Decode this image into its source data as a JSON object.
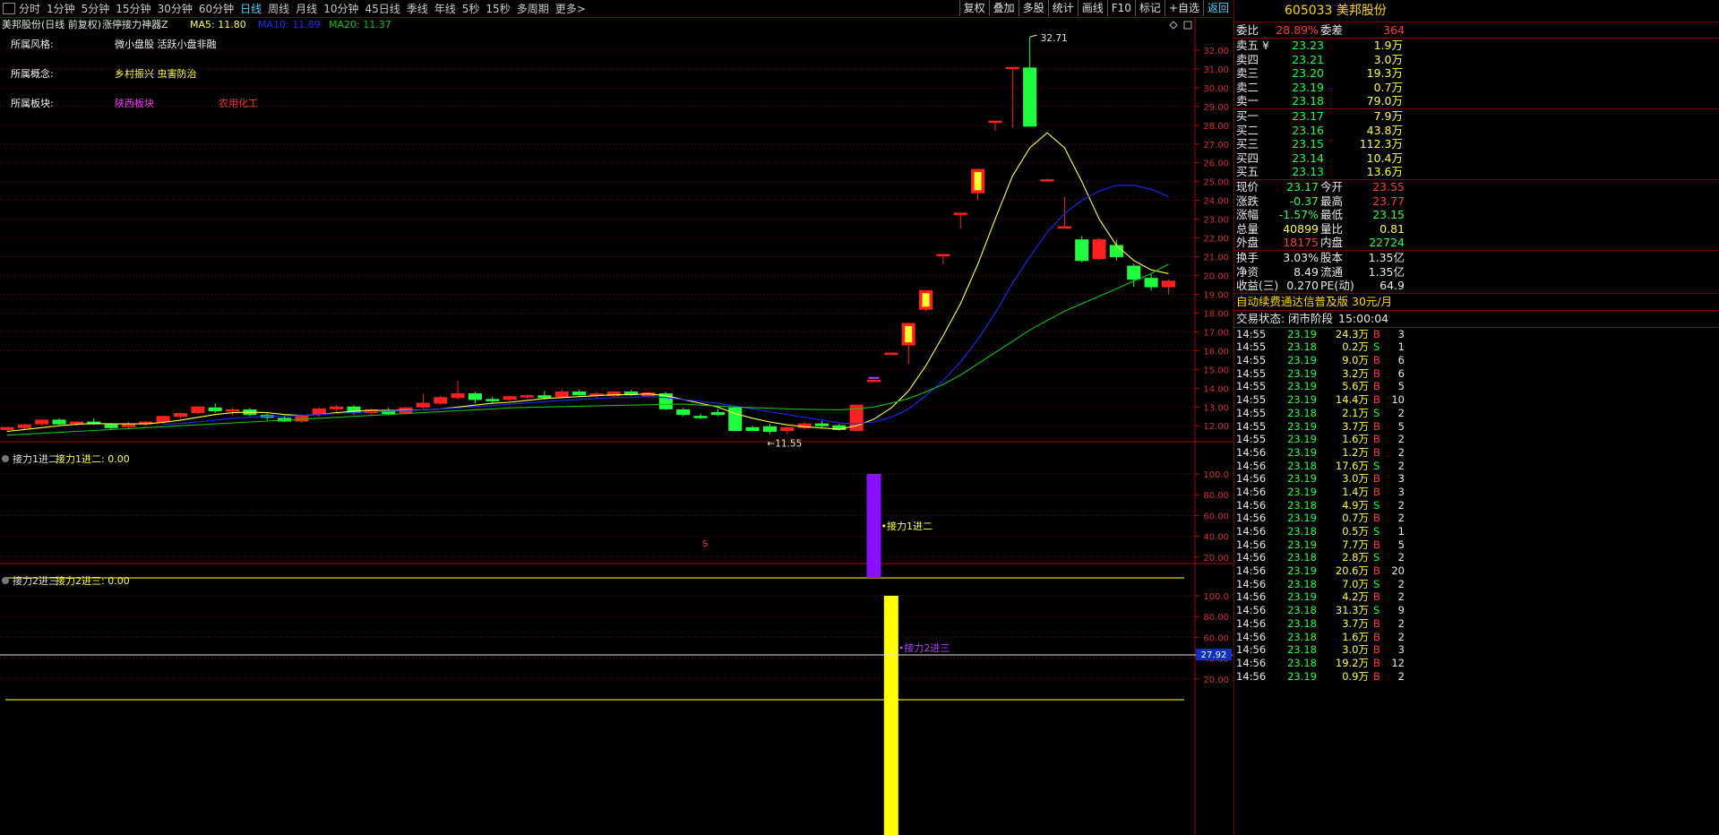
{
  "toolbar": {
    "periods": [
      "分时",
      "1分钟",
      "5分钟",
      "15分钟",
      "30分钟",
      "60分钟",
      "日线",
      "周线",
      "月线",
      "10分钟",
      "45日线",
      "季线",
      "年线",
      "5秒",
      "15秒",
      "多周期",
      "更多>"
    ],
    "active_period": "日线",
    "right_buttons": [
      "复权",
      "叠加",
      "多股",
      "统计",
      "画线",
      "F10",
      "标记",
      "+自选",
      "返回"
    ]
  },
  "main_panel": {
    "title": "美邦股份(日线 前复权)",
    "indicator": "涨停接力神器Z",
    "ma5": "MA5: 11.80",
    "ma10": "MA10: 11.89",
    "ma20": "MA20: 11.37",
    "info_labels": [
      "所属风格:",
      "所属概念:",
      "所属板块:"
    ],
    "style_value": "微小盘股 活跃小盘非融",
    "concept_value": "乡村振兴 虫害防治",
    "sector_values": [
      "陕西板块",
      "农用化工"
    ],
    "high_label": "32.71",
    "low_label": "11.55",
    "s_marker": "S",
    "colors": {
      "up": "#ff2020",
      "down": "#1fff3f",
      "ma5": "#ffff40",
      "ma10": "#1a2aff",
      "ma20": "#10c010",
      "axis": "#b00000",
      "grid": "#6a0000"
    }
  },
  "sub_panel_1": {
    "title": "接力1进二",
    "label": "接力1进二: 0.00",
    "annotation": "接力1进二",
    "color": "#8a10ff"
  },
  "sub_panel_2": {
    "title": "接力2进三",
    "label": "接力2进三: 0.00",
    "annotation": "接力2进三",
    "color": "#ffff00",
    "crosshair_value": "27.92"
  },
  "chart_data": {
    "type": "candlestick",
    "y_ticks": [
      "32.00",
      "31.00",
      "30.00",
      "29.00",
      "28.00",
      "27.00",
      "26.00",
      "25.00",
      "24.00",
      "23.00",
      "22.00",
      "21.00",
      "20.00",
      "19.00",
      "18.00",
      "17.00",
      "16.00",
      "15.00",
      "14.00",
      "13.00",
      "12.00"
    ],
    "ylim": [
      11.2,
      33.0
    ],
    "candles": [
      [
        11.8,
        11.95,
        11.7,
        11.9
      ],
      [
        11.9,
        12.1,
        11.8,
        12.05
      ],
      [
        12.1,
        12.35,
        12.0,
        12.3
      ],
      [
        12.3,
        12.4,
        12.05,
        12.1
      ],
      [
        12.15,
        12.25,
        12.0,
        12.2
      ],
      [
        12.2,
        12.4,
        12.05,
        12.1
      ],
      [
        12.05,
        12.15,
        11.8,
        11.9
      ],
      [
        11.95,
        12.2,
        11.85,
        12.1
      ],
      [
        12.1,
        12.25,
        12.0,
        12.2
      ],
      [
        12.2,
        12.55,
        12.1,
        12.5
      ],
      [
        12.5,
        12.7,
        12.4,
        12.65
      ],
      [
        12.7,
        13.05,
        12.6,
        13.0
      ],
      [
        12.95,
        13.2,
        12.7,
        12.8
      ],
      [
        12.8,
        12.95,
        12.55,
        12.85
      ],
      [
        12.85,
        12.95,
        12.5,
        12.6
      ],
      [
        12.55,
        12.65,
        12.3,
        12.45
      ],
      [
        12.4,
        12.5,
        12.2,
        12.25
      ],
      [
        12.25,
        12.6,
        12.15,
        12.55
      ],
      [
        12.6,
        12.95,
        12.5,
        12.9
      ],
      [
        12.9,
        13.1,
        12.75,
        13.0
      ],
      [
        13.0,
        13.1,
        12.6,
        12.7
      ],
      [
        12.7,
        12.9,
        12.6,
        12.85
      ],
      [
        12.8,
        12.95,
        12.55,
        12.65
      ],
      [
        12.7,
        13.0,
        12.6,
        12.95
      ],
      [
        13.0,
        13.7,
        12.9,
        13.2
      ],
      [
        13.2,
        13.6,
        13.1,
        13.5
      ],
      [
        13.5,
        14.4,
        13.4,
        13.7
      ],
      [
        13.7,
        13.8,
        13.2,
        13.4
      ],
      [
        13.4,
        13.55,
        13.2,
        13.35
      ],
      [
        13.4,
        13.6,
        13.3,
        13.55
      ],
      [
        13.55,
        13.65,
        13.45,
        13.6
      ],
      [
        13.6,
        13.85,
        13.4,
        13.5
      ],
      [
        13.55,
        13.95,
        13.5,
        13.8
      ],
      [
        13.8,
        13.9,
        13.55,
        13.65
      ],
      [
        13.65,
        13.8,
        13.5,
        13.7
      ],
      [
        13.6,
        13.85,
        13.5,
        13.8
      ],
      [
        13.8,
        13.9,
        13.6,
        13.7
      ],
      [
        13.6,
        13.8,
        13.5,
        13.75
      ],
      [
        13.7,
        13.8,
        12.85,
        12.9
      ],
      [
        12.85,
        12.95,
        12.5,
        12.6
      ],
      [
        12.5,
        12.65,
        12.35,
        12.45
      ],
      [
        12.7,
        12.9,
        12.5,
        12.6
      ],
      [
        12.95,
        13.05,
        11.7,
        11.75
      ],
      [
        11.9,
        12.0,
        11.7,
        11.75
      ],
      [
        11.95,
        12.1,
        11.55,
        11.7
      ],
      [
        11.75,
        11.95,
        11.55,
        11.9
      ],
      [
        11.9,
        12.2,
        11.8,
        12.1
      ],
      [
        12.1,
        12.25,
        11.9,
        12.0
      ],
      [
        12.0,
        12.1,
        11.75,
        11.8
      ],
      [
        11.75,
        13.1,
        11.7,
        13.1
      ],
      [
        14.4,
        14.45,
        14.4,
        14.42
      ],
      [
        15.85,
        15.9,
        15.85,
        15.87
      ],
      [
        16.3,
        17.45,
        15.3,
        17.45
      ],
      [
        18.2,
        19.2,
        18.1,
        19.2
      ],
      [
        21.1,
        21.15,
        20.6,
        21.12
      ],
      [
        23.3,
        23.35,
        22.5,
        23.32
      ],
      [
        24.4,
        25.65,
        24.0,
        25.65
      ],
      [
        28.2,
        28.25,
        27.7,
        28.22
      ],
      [
        31.05,
        31.1,
        27.85,
        31.08
      ],
      [
        31.05,
        32.71,
        27.95,
        27.95
      ],
      [
        25.1,
        25.15,
        25.05,
        25.1
      ],
      [
        22.6,
        24.2,
        22.55,
        22.6
      ],
      [
        21.9,
        22.1,
        20.7,
        20.8
      ],
      [
        20.9,
        22.0,
        20.8,
        21.9
      ],
      [
        21.6,
        21.9,
        20.8,
        21.0
      ],
      [
        20.5,
        20.65,
        19.4,
        19.8
      ],
      [
        19.85,
        20.1,
        19.2,
        19.4
      ],
      [
        19.4,
        19.8,
        19.0,
        19.7
      ]
    ],
    "ma5": [
      11.7,
      11.8,
      11.9,
      12.0,
      12.08,
      12.12,
      12.1,
      12.1,
      12.1,
      12.18,
      12.3,
      12.45,
      12.6,
      12.7,
      12.72,
      12.7,
      12.6,
      12.55,
      12.6,
      12.7,
      12.78,
      12.82,
      12.82,
      12.82,
      12.85,
      12.9,
      13.0,
      13.1,
      13.2,
      13.25,
      13.35,
      13.45,
      13.5,
      13.55,
      13.6,
      13.65,
      13.65,
      13.7,
      13.6,
      13.4,
      13.2,
      13.0,
      12.65,
      12.4,
      12.2,
      12.05,
      11.95,
      11.88,
      11.82,
      12.0,
      12.35,
      12.95,
      13.85,
      15.2,
      16.8,
      18.5,
      20.6,
      23.0,
      25.3,
      26.8,
      27.6,
      26.8,
      25.0,
      23.0,
      21.6,
      20.8,
      20.3,
      20.1
    ],
    "ma10": [
      null,
      null,
      null,
      null,
      null,
      null,
      null,
      null,
      null,
      12.08,
      12.12,
      12.2,
      12.3,
      12.4,
      12.45,
      12.5,
      12.52,
      12.55,
      12.6,
      12.65,
      12.7,
      12.75,
      12.78,
      12.8,
      12.85,
      12.9,
      12.95,
      13.02,
      13.08,
      13.15,
      13.22,
      13.28,
      13.35,
      13.4,
      13.45,
      13.5,
      13.52,
      13.55,
      13.5,
      13.4,
      13.3,
      13.2,
      13.05,
      12.9,
      12.75,
      12.6,
      12.45,
      12.3,
      12.15,
      12.1,
      12.2,
      12.45,
      12.9,
      13.6,
      14.4,
      15.4,
      16.6,
      18.0,
      19.6,
      21.0,
      22.3,
      23.3,
      24.0,
      24.5,
      24.8,
      24.8,
      24.6,
      24.2,
      23.6,
      23.0
    ],
    "ma20": [
      11.5,
      11.55,
      11.6,
      11.65,
      11.7,
      11.75,
      11.8,
      11.85,
      11.9,
      11.95,
      12.0,
      12.05,
      12.1,
      12.15,
      12.2,
      12.25,
      12.3,
      12.35,
      12.4,
      12.45,
      12.5,
      12.55,
      12.6,
      12.65,
      12.7,
      12.75,
      12.8,
      12.85,
      12.9,
      12.95,
      12.98,
      13.0,
      13.02,
      13.04,
      13.06,
      13.08,
      13.1,
      13.12,
      13.14,
      13.15,
      13.1,
      13.05,
      13.0,
      12.96,
      12.93,
      12.9,
      12.88,
      12.86,
      12.85,
      12.9,
      13.0,
      13.2,
      13.45,
      13.8,
      14.2,
      14.7,
      15.3,
      15.9,
      16.5,
      17.1,
      17.6,
      18.1,
      18.5,
      18.9,
      19.3,
      19.7,
      20.1,
      20.6
    ],
    "sub1": {
      "y_ticks": [
        "100.0",
        "80.00",
        "60.00",
        "40.00",
        "20.00"
      ],
      "ylim": [
        0,
        100
      ],
      "bar_index": 50,
      "bar_value": 100
    },
    "sub2": {
      "y_ticks": [
        "100.0",
        "80.00",
        "60.00",
        "40.00",
        "20.00"
      ],
      "ylim": [
        0,
        100
      ],
      "bar_index": 51,
      "bar_value": 100
    }
  },
  "stock": {
    "code": "605033",
    "name": "美邦股份",
    "wei_bi_label": "委比",
    "wei_bi_value": "28.89%",
    "wei_cha_label": "委差",
    "wei_cha_value": "364"
  },
  "order_book": {
    "sells": [
      {
        "label": "卖五 ¥",
        "price": "23.23",
        "vol": "1.9万"
      },
      {
        "label": "卖四",
        "price": "23.21",
        "vol": "3.0万"
      },
      {
        "label": "卖三",
        "price": "23.20",
        "vol": "19.3万"
      },
      {
        "label": "卖二",
        "price": "23.19",
        "vol": "0.7万"
      },
      {
        "label": "卖一",
        "price": "23.18",
        "vol": "79.0万"
      }
    ],
    "buys": [
      {
        "label": "买一",
        "price": "23.17",
        "vol": "7.9万"
      },
      {
        "label": "买二",
        "price": "23.16",
        "vol": "43.8万"
      },
      {
        "label": "买三",
        "price": "23.15",
        "vol": "112.3万"
      },
      {
        "label": "买四",
        "price": "23.14",
        "vol": "10.4万"
      },
      {
        "label": "买五",
        "price": "23.13",
        "vol": "13.6万"
      }
    ]
  },
  "quote_stats": [
    [
      {
        "l": "现价",
        "v": "23.17",
        "c": "g"
      },
      {
        "l": "今开",
        "v": "23.55",
        "c": "r"
      }
    ],
    [
      {
        "l": "涨跌",
        "v": "-0.37",
        "c": "g"
      },
      {
        "l": "最高",
        "v": "23.77",
        "c": "r"
      }
    ],
    [
      {
        "l": "涨幅",
        "v": "-1.57%",
        "c": "g"
      },
      {
        "l": "最低",
        "v": "23.15",
        "c": "g"
      }
    ],
    [
      {
        "l": "总量",
        "v": "40899",
        "c": "y"
      },
      {
        "l": "量比",
        "v": "0.81",
        "c": "y"
      }
    ],
    [
      {
        "l": "外盘",
        "v": "18175",
        "c": "r"
      },
      {
        "l": "内盘",
        "v": "22724",
        "c": "g"
      }
    ]
  ],
  "quote_stats2": [
    [
      {
        "l": "换手",
        "v": "3.03%",
        "c": "w"
      },
      {
        "l": "股本",
        "v": "1.35亿",
        "c": "w"
      }
    ],
    [
      {
        "l": "净资",
        "v": "8.49",
        "c": "w"
      },
      {
        "l": "流通",
        "v": "1.35亿",
        "c": "w"
      }
    ],
    [
      {
        "l": "收益(三)",
        "v": "0.270",
        "c": "w"
      },
      {
        "l": "PE(动)",
        "v": "64.9",
        "c": "w"
      }
    ]
  ],
  "promo": {
    "text": "自动续费通达信普及版",
    "price": "30元/月"
  },
  "trade_status": {
    "label": "交易状态:",
    "value": "闭市阶段",
    "time": "15:00:04"
  },
  "trades": [
    {
      "t": "14:55",
      "p": "23.19",
      "v": "24.3万",
      "s": "B",
      "n": "3"
    },
    {
      "t": "14:55",
      "p": "23.18",
      "v": "0.2万",
      "s": "S",
      "n": "1"
    },
    {
      "t": "14:55",
      "p": "23.19",
      "v": "9.0万",
      "s": "B",
      "n": "6"
    },
    {
      "t": "14:55",
      "p": "23.19",
      "v": "3.2万",
      "s": "B",
      "n": "6"
    },
    {
      "t": "14:55",
      "p": "23.19",
      "v": "5.6万",
      "s": "B",
      "n": "5"
    },
    {
      "t": "14:55",
      "p": "23.19",
      "v": "14.4万",
      "s": "B",
      "n": "10"
    },
    {
      "t": "14:55",
      "p": "23.18",
      "v": "2.1万",
      "s": "S",
      "n": "2"
    },
    {
      "t": "14:55",
      "p": "23.19",
      "v": "3.7万",
      "s": "B",
      "n": "5"
    },
    {
      "t": "14:55",
      "p": "23.19",
      "v": "1.6万",
      "s": "B",
      "n": "2"
    },
    {
      "t": "14:56",
      "p": "23.19",
      "v": "1.2万",
      "s": "B",
      "n": "2"
    },
    {
      "t": "14:56",
      "p": "23.18",
      "v": "17.6万",
      "s": "S",
      "n": "2"
    },
    {
      "t": "14:56",
      "p": "23.19",
      "v": "3.0万",
      "s": "B",
      "n": "3"
    },
    {
      "t": "14:56",
      "p": "23.19",
      "v": "1.4万",
      "s": "B",
      "n": "3"
    },
    {
      "t": "14:56",
      "p": "23.18",
      "v": "4.9万",
      "s": "S",
      "n": "2"
    },
    {
      "t": "14:56",
      "p": "23.19",
      "v": "0.7万",
      "s": "B",
      "n": "2"
    },
    {
      "t": "14:56",
      "p": "23.18",
      "v": "0.5万",
      "s": "S",
      "n": "1"
    },
    {
      "t": "14:56",
      "p": "23.19",
      "v": "7.7万",
      "s": "B",
      "n": "5"
    },
    {
      "t": "14:56",
      "p": "23.18",
      "v": "2.8万",
      "s": "S",
      "n": "2"
    },
    {
      "t": "14:56",
      "p": "23.19",
      "v": "20.6万",
      "s": "B",
      "n": "20"
    },
    {
      "t": "14:56",
      "p": "23.18",
      "v": "7.0万",
      "s": "S",
      "n": "2"
    },
    {
      "t": "14:56",
      "p": "23.19",
      "v": "4.2万",
      "s": "B",
      "n": "2"
    },
    {
      "t": "14:56",
      "p": "23.18",
      "v": "31.3万",
      "s": "S",
      "n": "9"
    },
    {
      "t": "14:56",
      "p": "23.18",
      "v": "3.7万",
      "s": "B",
      "n": "2"
    },
    {
      "t": "14:56",
      "p": "23.18",
      "v": "1.6万",
      "s": "B",
      "n": "2"
    },
    {
      "t": "14:56",
      "p": "23.18",
      "v": "3.0万",
      "s": "B",
      "n": "3"
    },
    {
      "t": "14:56",
      "p": "23.18",
      "v": "19.2万",
      "s": "B",
      "n": "12"
    },
    {
      "t": "14:56",
      "p": "23.19",
      "v": "0.9万",
      "s": "B",
      "n": "2"
    }
  ]
}
